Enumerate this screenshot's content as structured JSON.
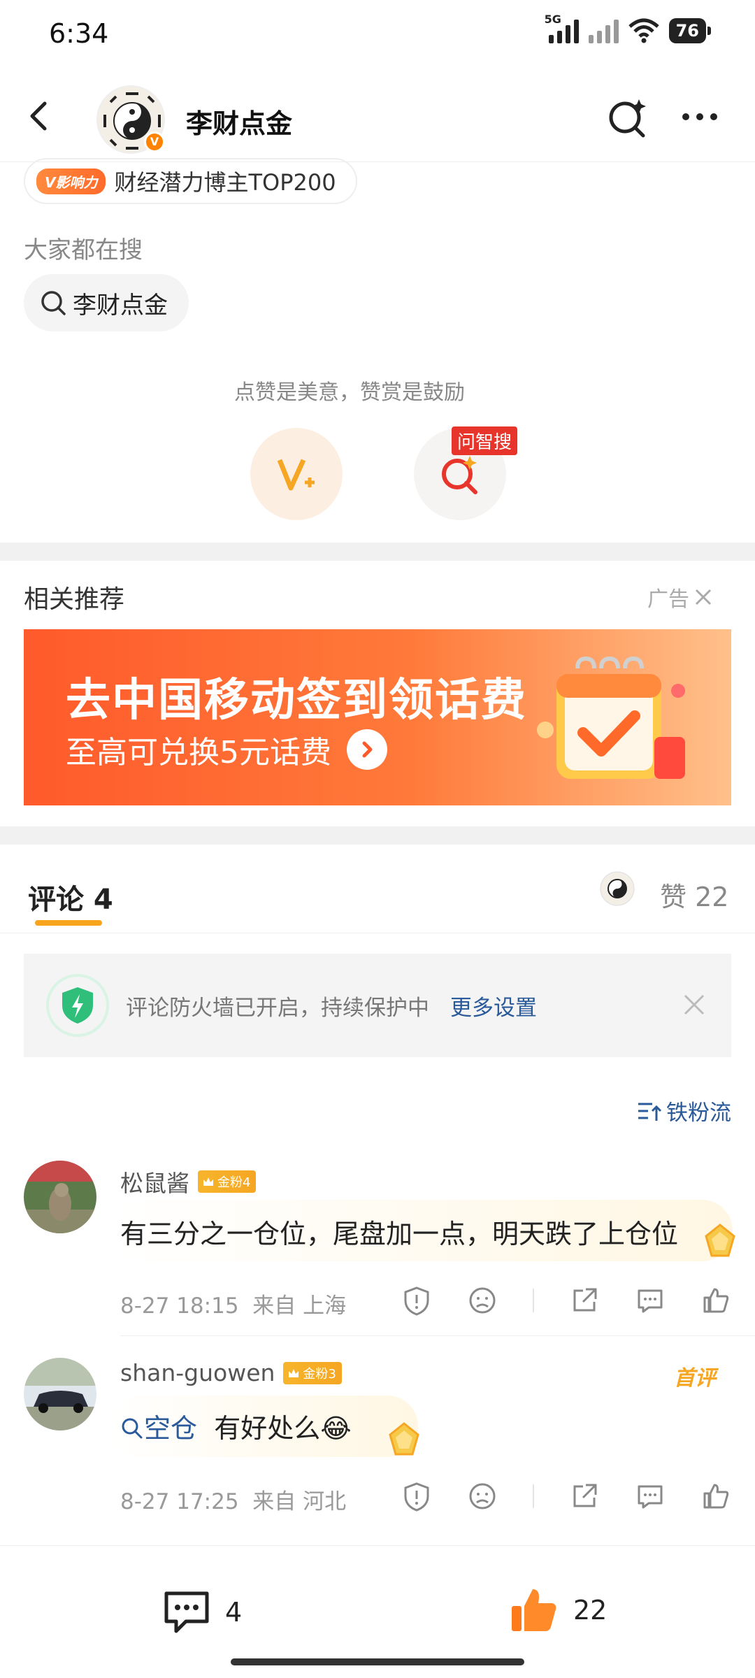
{
  "status_bar": {
    "time": "6:34",
    "network": "5G",
    "battery": "76"
  },
  "header": {
    "account_name": "李财点金",
    "verified_badge": "V"
  },
  "profile": {
    "influence_tag": "V影响力",
    "influence_text": "财经潜力博主TOP200",
    "search_title": "大家都在搜",
    "search_chip": "李财点金"
  },
  "reward": {
    "text": "点赞是美意，赞赏是鼓励",
    "wenzhi_label": "问智搜"
  },
  "recommend": {
    "title": "相关推荐",
    "ad_label": "广告",
    "ad_headline": "去中国移动签到领话费",
    "ad_sub": "至高可兑换5元话费"
  },
  "comments_tab": {
    "label": "评论 4",
    "likes_label": "赞 22"
  },
  "firewall": {
    "text": "评论防火墙已开启，持续保护中",
    "link": "更多设置"
  },
  "sort_label": "铁粉流",
  "comments": [
    {
      "user": "松鼠酱",
      "badge": "金粉4",
      "text": "有三分之一仓位，尾盘加一点，明天跌了上仓位",
      "time": "8-27 18:15",
      "location": "来自 上海"
    },
    {
      "user": "shan-guowen",
      "badge": "金粉3",
      "first_tag": "首评",
      "topic": "空仓",
      "text": "有好处么😂",
      "time": "8-27 17:25",
      "location": "来自 河北"
    }
  ],
  "bottom_bar": {
    "comment_count": "4",
    "like_count": "22"
  },
  "colors": {
    "accent": "#ff8200",
    "link": "#2a5a9a",
    "gold": "#f5a623"
  }
}
